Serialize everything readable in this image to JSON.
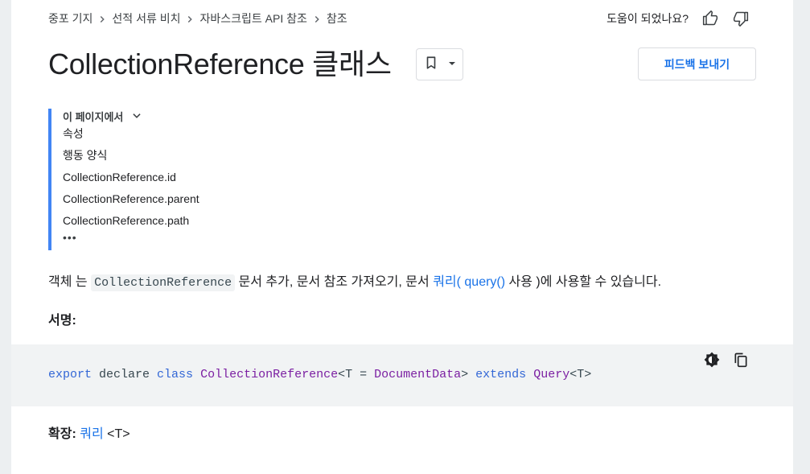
{
  "breadcrumb": [
    "중포 기지",
    "선적 서류 비치",
    "자바스크립트 API 참조",
    "참조"
  ],
  "helpful": {
    "question": "도움이 되었나요?",
    "up_icon": "thumb-up-icon",
    "down_icon": "thumb-down-icon"
  },
  "header": {
    "title": "CollectionReference 클래스",
    "bookmark_icon": "bookmark-icon",
    "feedback_label": "피드백 보내기"
  },
  "toc": {
    "heading": "이 페이지에서",
    "items": [
      "속성",
      "행동 양식",
      "CollectionReference.id",
      "CollectionReference.parent",
      "CollectionReference.path"
    ],
    "more": "•••"
  },
  "description": {
    "prefix": "객체 는 ",
    "code": "CollectionReference",
    "middle": " 문서 추가, 문서 참조 가져오기, 문서 ",
    "link": "쿼리( query()",
    "suffix": " 사용 )에 사용할 수 있습니다."
  },
  "signature": {
    "label": "서명:",
    "tokens": {
      "t1": "export",
      "t2": " declare ",
      "t3": "class",
      "t4": " ",
      "t5": "CollectionReference",
      "t6": "<T = ",
      "t7": "DocumentData",
      "t8": "> ",
      "t9": "extends",
      "t10": " ",
      "t11": "Query",
      "t12": "<T>"
    },
    "theme_icon": "dark-theme-icon",
    "copy_icon": "copy-icon"
  },
  "extends": {
    "label": "확장:",
    "link": "쿼리",
    "suffix": " <T>"
  },
  "colors": {
    "link": "#1a73e8",
    "accent_bar": "#4285f4",
    "code_bg": "#f1f3f4",
    "keyword": "#3367d6",
    "type": "#7b1fa2"
  }
}
